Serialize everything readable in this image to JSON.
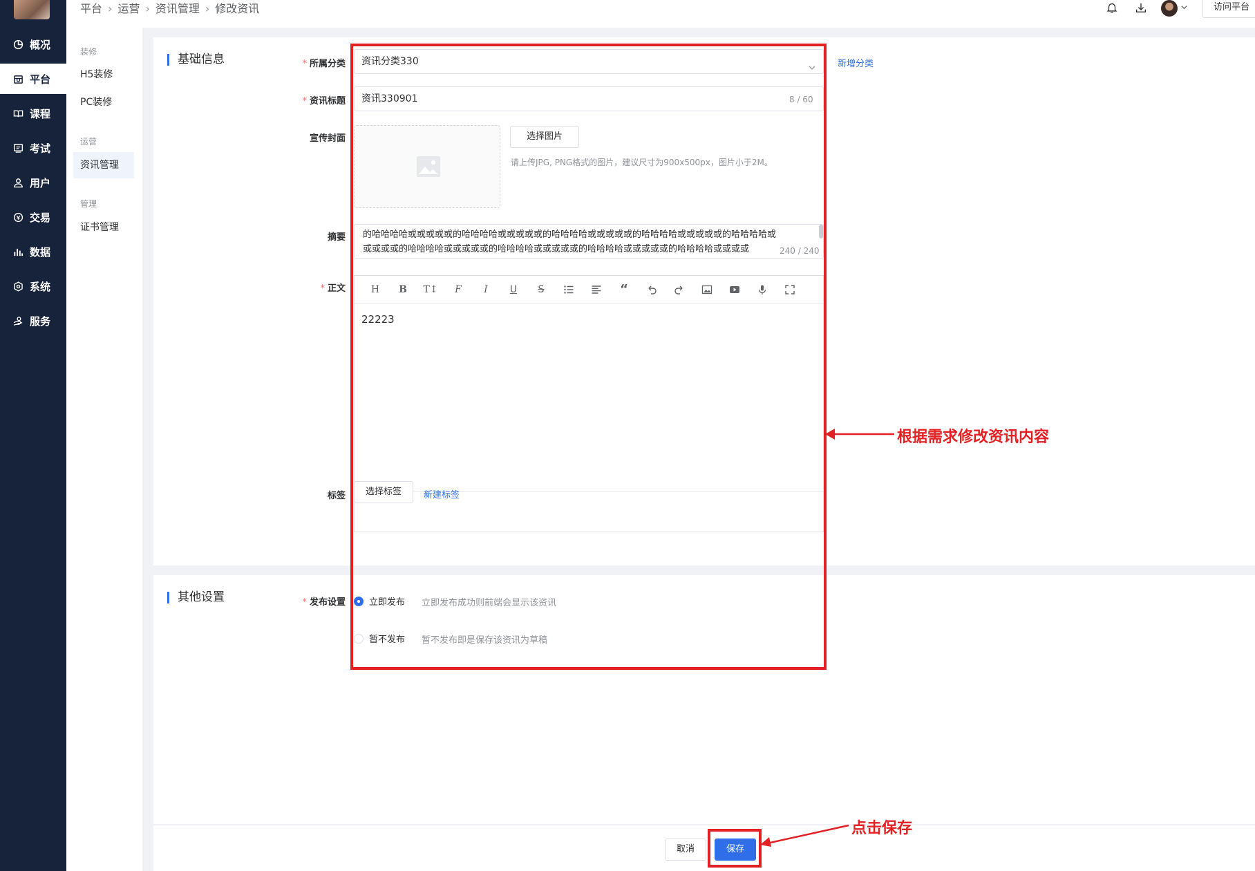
{
  "nav": {
    "items": [
      {
        "label": "概况",
        "icon": "pie-chart-icon"
      },
      {
        "label": "平台",
        "icon": "store-icon",
        "active": true
      },
      {
        "label": "课程",
        "icon": "book-icon"
      },
      {
        "label": "考试",
        "icon": "exam-icon"
      },
      {
        "label": "用户",
        "icon": "user-icon"
      },
      {
        "label": "交易",
        "icon": "exchange-icon"
      },
      {
        "label": "数据",
        "icon": "bar-chart-icon"
      },
      {
        "label": "系统",
        "icon": "gear-icon"
      },
      {
        "label": "服务",
        "icon": "service-icon"
      }
    ]
  },
  "subnav": {
    "groups": [
      {
        "title": "装修",
        "items": [
          "H5装修",
          "PC装修"
        ]
      },
      {
        "title": "运营",
        "items": [
          "资讯管理"
        ]
      },
      {
        "title": "管理",
        "items": [
          "证书管理"
        ]
      }
    ]
  },
  "header": {
    "breadcrumb": [
      "平台",
      "运营",
      "资讯管理",
      "修改资讯"
    ],
    "visit_label": "访问平台"
  },
  "basic": {
    "section_title": "基础信息",
    "category": {
      "label": "所属分类",
      "value": "资讯分类330",
      "add_link": "新增分类"
    },
    "title": {
      "label": "资讯标题",
      "value": "资讯330901",
      "counter": "8 / 60"
    },
    "cover": {
      "label": "宣传封面",
      "button": "选择图片",
      "hint": "请上传JPG, PNG格式的图片，建议尺寸为900x500px，图片小于2M。"
    },
    "summary": {
      "label": "摘要",
      "line1": "的哈哈哈哈或或或或或的哈哈哈哈或或或或或的哈哈哈哈或或或或或的哈哈哈哈或或或或或的哈哈哈哈或",
      "line2": "或或或或的哈哈哈哈或或或或或的哈哈哈哈或或或或或的哈哈哈哈或或或或或的哈哈哈哈或或或或",
      "counter": "240 / 240"
    },
    "body": {
      "label": "正文",
      "content": "22223"
    },
    "tags": {
      "label": "标签",
      "button": "选择标签",
      "link": "新建标签"
    }
  },
  "other": {
    "section_title": "其他设置",
    "publish_label": "发布设置",
    "options": [
      {
        "label": "立即发布",
        "desc": "立即发布成功则前端会显示该资讯",
        "checked": true
      },
      {
        "label": "暂不发布",
        "desc": "暂不发布即是保存该资讯为草稿",
        "checked": false
      }
    ]
  },
  "footer": {
    "cancel": "取消",
    "save": "保存"
  },
  "annotations": {
    "content_note": "根据需求修改资讯内容",
    "save_note": "点击保存",
    "color": "#e32124"
  },
  "colors": {
    "primary": "#2f6ee8",
    "nav_bg": "#17223b",
    "required": "#f56c6c"
  }
}
